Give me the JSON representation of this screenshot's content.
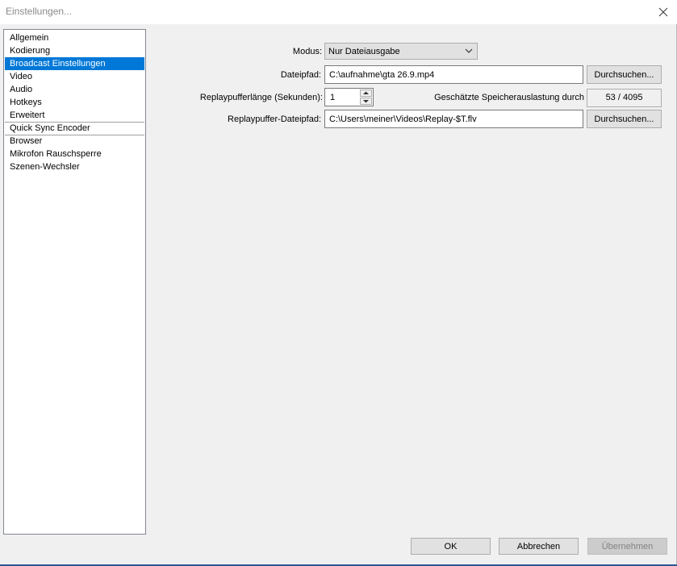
{
  "window": {
    "title": "Einstellungen..."
  },
  "sidebar": {
    "items": [
      {
        "label": "Allgemein"
      },
      {
        "label": "Kodierung"
      },
      {
        "label": "Broadcast Einstellungen",
        "selected": true
      },
      {
        "label": "Video"
      },
      {
        "label": "Audio"
      },
      {
        "label": "Hotkeys"
      },
      {
        "label": "Erweitert"
      },
      {
        "label": "Quick Sync Encoder"
      },
      {
        "label": "Browser"
      },
      {
        "label": "Mikrofon Rauschsperre"
      },
      {
        "label": "Szenen-Wechsler"
      }
    ]
  },
  "form": {
    "mode": {
      "label": "Modus:",
      "value": "Nur Dateiausgabe"
    },
    "filepath": {
      "label": "Dateipfad:",
      "value": "C:\\aufnahme\\gta 26.9.mp4",
      "browse_label": "Durchsuchen..."
    },
    "replay_length": {
      "label": "Replaypufferlänge (Sekunden):",
      "value": "1"
    },
    "memory": {
      "label": "Geschätzte Speicherauslastung durch",
      "value": "53 / 4095"
    },
    "replay_path": {
      "label": "Replaypuffer-Dateipfad:",
      "value": "C:\\Users\\meiner\\Videos\\Replay-$T.flv",
      "browse_label": "Durchsuchen..."
    }
  },
  "footer": {
    "ok_label": "OK",
    "cancel_label": "Abbrechen",
    "apply_label": "Übernehmen"
  },
  "colors": {
    "selection": "#0078d7",
    "background": "#f0f0f0"
  }
}
